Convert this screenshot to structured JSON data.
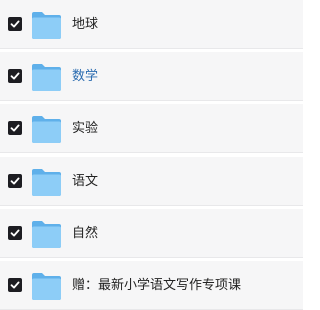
{
  "items": [
    {
      "label": "地球",
      "checked": true,
      "active": false
    },
    {
      "label": "数学",
      "checked": true,
      "active": true
    },
    {
      "label": "实验",
      "checked": true,
      "active": false
    },
    {
      "label": "语文",
      "checked": true,
      "active": false
    },
    {
      "label": "自然",
      "checked": true,
      "active": false
    },
    {
      "label": "赠：最新小学语文写作专项课",
      "checked": true,
      "active": false
    }
  ],
  "icons": {
    "checkbox": "checkbox-checked-icon",
    "folder": "folder-icon"
  },
  "colors": {
    "row_background": "#f6f6f7",
    "checkbox": "#1d1d22",
    "folder": "#7fc3f3",
    "active_label": "#2b6cb0",
    "label": "#222222"
  }
}
